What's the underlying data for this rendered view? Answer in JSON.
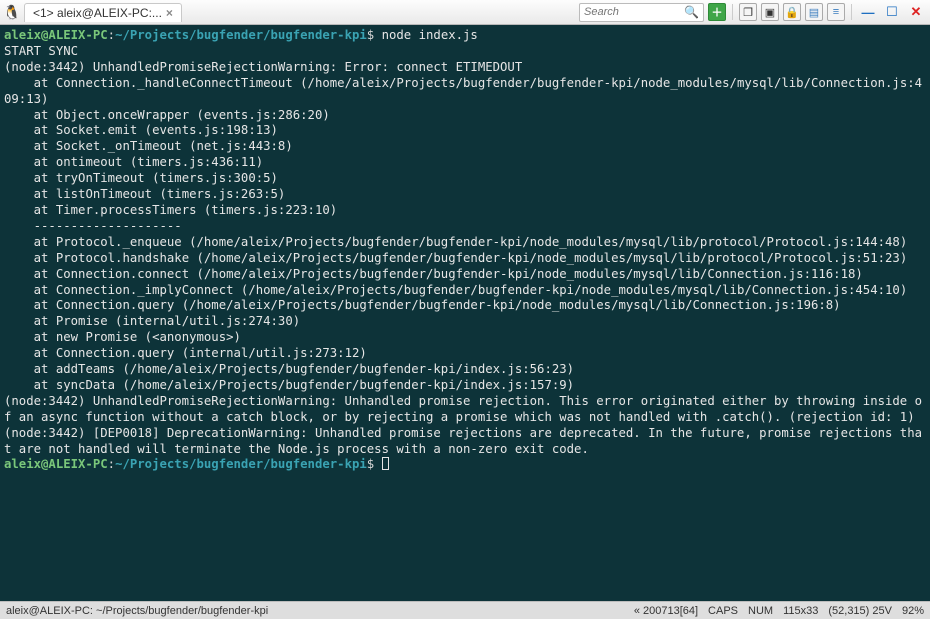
{
  "titlebar": {
    "tab_label": "<1> aleix@ALEIX-PC:...",
    "search_placeholder": "Search"
  },
  "prompt": {
    "user": "aleix@ALEIX-PC",
    "sep": ":",
    "path": "~/Projects/bugfender/bugfender-kpi",
    "dollar": "$",
    "command": "node index.js"
  },
  "output_lines": [
    "START SYNC",
    "(node:3442) UnhandledPromiseRejectionWarning: Error: connect ETIMEDOUT",
    "    at Connection._handleConnectTimeout (/home/aleix/Projects/bugfender/bugfender-kpi/node_modules/mysql/lib/Connection.js:409:13)",
    "    at Object.onceWrapper (events.js:286:20)",
    "    at Socket.emit (events.js:198:13)",
    "    at Socket._onTimeout (net.js:443:8)",
    "    at ontimeout (timers.js:436:11)",
    "    at tryOnTimeout (timers.js:300:5)",
    "    at listOnTimeout (timers.js:263:5)",
    "    at Timer.processTimers (timers.js:223:10)",
    "    --------------------",
    "    at Protocol._enqueue (/home/aleix/Projects/bugfender/bugfender-kpi/node_modules/mysql/lib/protocol/Protocol.js:144:48)",
    "    at Protocol.handshake (/home/aleix/Projects/bugfender/bugfender-kpi/node_modules/mysql/lib/protocol/Protocol.js:51:23)",
    "    at Connection.connect (/home/aleix/Projects/bugfender/bugfender-kpi/node_modules/mysql/lib/Connection.js:116:18)",
    "    at Connection._implyConnect (/home/aleix/Projects/bugfender/bugfender-kpi/node_modules/mysql/lib/Connection.js:454:10)",
    "    at Connection.query (/home/aleix/Projects/bugfender/bugfender-kpi/node_modules/mysql/lib/Connection.js:196:8)",
    "    at Promise (internal/util.js:274:30)",
    "    at new Promise (<anonymous>)",
    "    at Connection.query (internal/util.js:273:12)",
    "    at addTeams (/home/aleix/Projects/bugfender/bugfender-kpi/index.js:56:23)",
    "    at syncData (/home/aleix/Projects/bugfender/bugfender-kpi/index.js:157:9)",
    "(node:3442) UnhandledPromiseRejectionWarning: Unhandled promise rejection. This error originated either by throwing inside of an async function without a catch block, or by rejecting a promise which was not handled with .catch(). (rejection id: 1)",
    "(node:3442) [DEP0018] DeprecationWarning: Unhandled promise rejections are deprecated. In the future, promise rejections that are not handled will terminate the Node.js process with a non-zero exit code."
  ],
  "statusbar": {
    "left": "aleix@ALEIX-PC: ~/Projects/bugfender/bugfender-kpi",
    "enc": "« 200713[64]",
    "caps": "CAPS",
    "num": "NUM",
    "size": "115x33",
    "pos": "(52,315) 25V",
    "pct": "92%"
  }
}
